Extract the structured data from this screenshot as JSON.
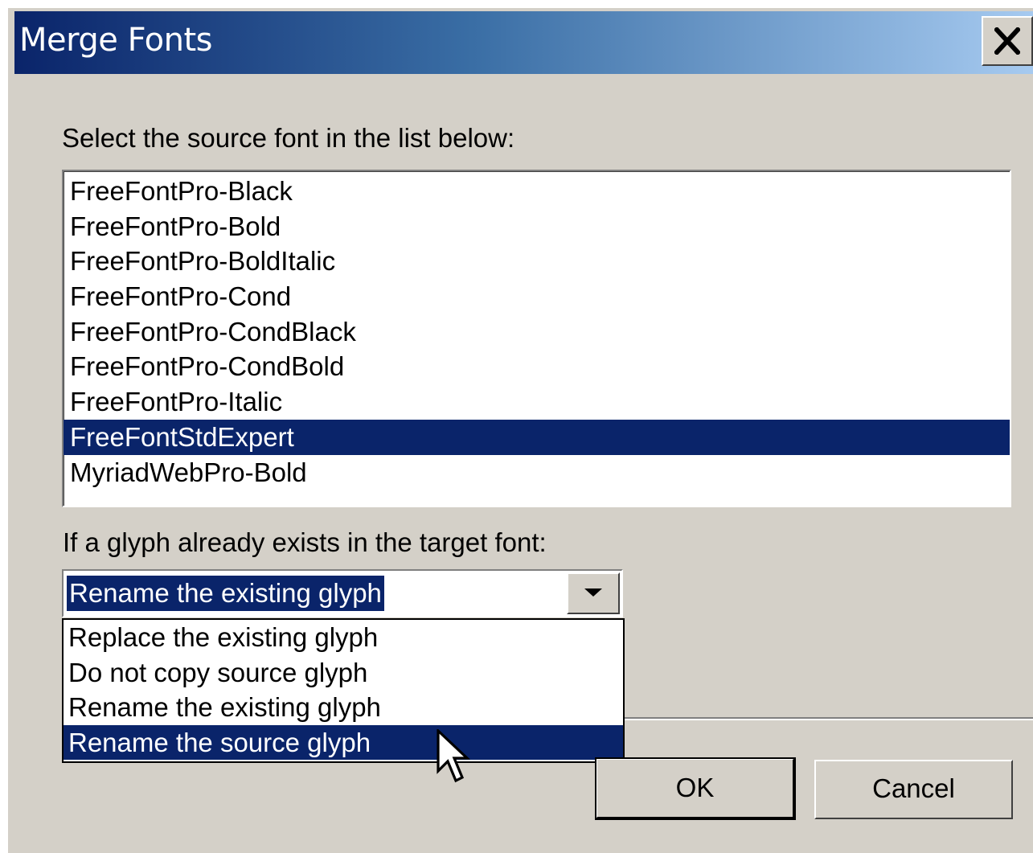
{
  "window": {
    "title": "Merge Fonts"
  },
  "source": {
    "label": "Select the source font in the list below:",
    "fonts": [
      "FreeFontPro-Black",
      "FreeFontPro-Bold",
      "FreeFontPro-BoldItalic",
      "FreeFontPro-Cond",
      "FreeFontPro-CondBlack",
      "FreeFontPro-CondBold",
      "FreeFontPro-Italic",
      "FreeFontStdExpert",
      "MyriadWebPro-Bold"
    ],
    "selected": "FreeFontStdExpert"
  },
  "glyph_conflict": {
    "label": "If a glyph already exists in the target font:",
    "current_value": "Rename the existing glyph",
    "options": [
      "Replace the existing glyph",
      "Do not copy source glyph",
      "Rename the existing glyph",
      "Rename the source glyph"
    ],
    "highlighted": "Rename the source glyph"
  },
  "buttons": {
    "ok_label": "OK",
    "cancel_label": "Cancel"
  },
  "colors": {
    "selection": "#0a246a",
    "dialog_bg": "#d4d0c8"
  },
  "icons": {
    "close": "close-x-icon",
    "dropdown": "triangle-down-icon",
    "cursor": "arrow-pointer-icon"
  }
}
